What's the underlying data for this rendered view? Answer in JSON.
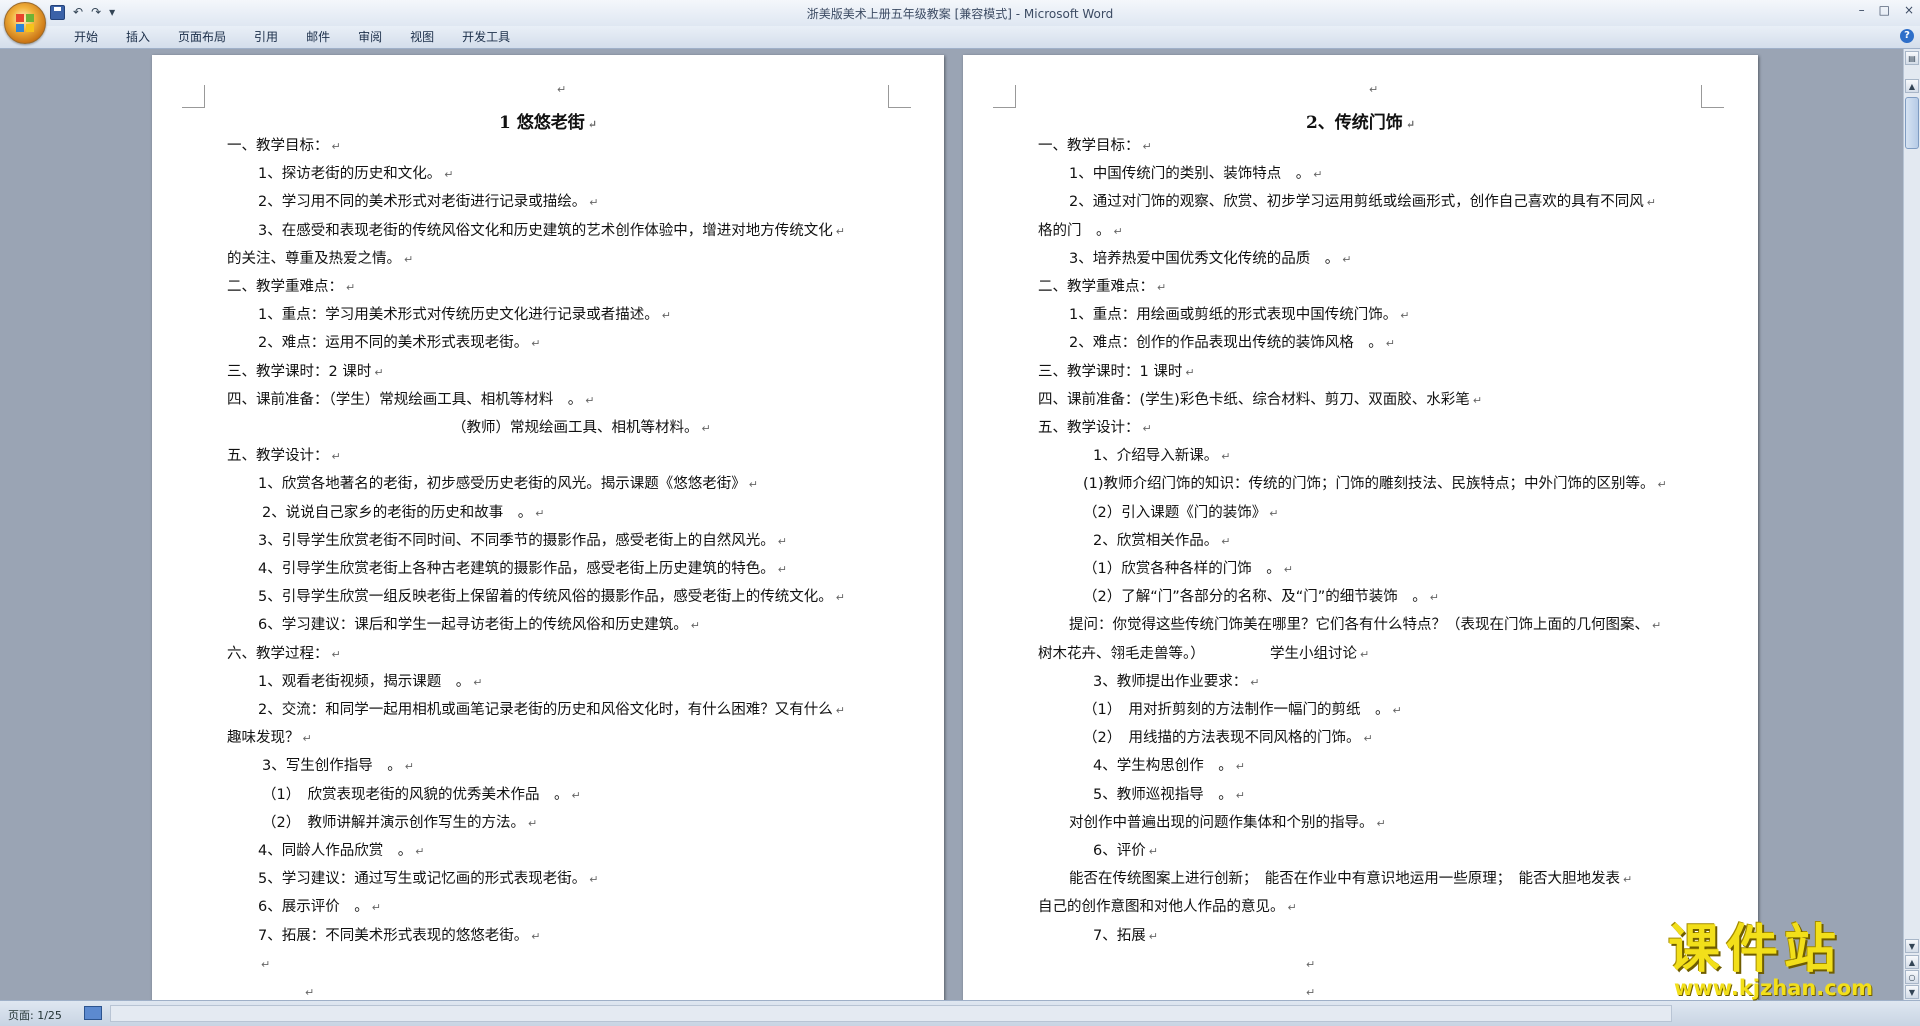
{
  "window": {
    "title": "浙美版美术上册五年级教案 [兼容模式] - Microsoft Word",
    "controls": [
      "–",
      "□",
      "×"
    ]
  },
  "quick_access": [
    "save-icon",
    "↶",
    "↷",
    "▾"
  ],
  "ribbon": {
    "tabs": [
      "开始",
      "插入",
      "页面布局",
      "引用",
      "邮件",
      "审阅",
      "视图",
      "开发工具"
    ],
    "help": "?"
  },
  "status": {
    "page": "页面: 1/25"
  },
  "watermark": {
    "main": "课件站",
    "url": "www.kjzhan.com"
  },
  "page1": {
    "title": "1 悠悠老街",
    "lines": [
      "一、教学目标：",
      "1、探访老街的历史和文化。",
      "2、学习用不同的美术形式对老街进行记录或描绘。",
      "3、在感受和表现老街的传统风俗文化和历史建筑的艺术创作体验中，增进对地方传统文化",
      "的关注、尊重及热爱之情。",
      "二、教学重难点：",
      "1、重点：学习用美术形式对传统历史文化进行记录或者描述。",
      "2、难点：运用不同的美术形式表现老街。",
      "三、教学课时：2 课时",
      "四、课前准备：（学生）常规绘画工具、相机等材料　。",
      "（教师）常规绘画工具、相机等材料。",
      "五、教学设计：",
      "1、欣赏各地著名的老街，初步感受历史老街的风光。揭示课题《悠悠老街》",
      "2、说说自己家乡的老街的历史和故事　。",
      "3、引导学生欣赏老街不同时间、不同季节的摄影作品，感受老街上的自然风光。",
      "4、引导学生欣赏老街上各种古老建筑的摄影作品，感受老街上历史建筑的特色。",
      "5、引导学生欣赏一组反映老街上保留着的传统风俗的摄影作品，感受老街上的传统文化。",
      "6、学习建议：课后和学生一起寻访老街上的传统风俗和历史建筑。",
      "六、教学过程：",
      "1、观看老街视频，揭示课题　。",
      "2、交流：和同学一起用相机或画笔记录老街的历史和风俗文化时，有什么困难？又有什么",
      "趣味发现？",
      "3、写生创作指导　。",
      "（1）　欣赏表现老街的风貌的优秀美术作品　。",
      "（2）　教师讲解并演示创作写生的方法。",
      "4、同龄人作品欣赏　。",
      "5、学习建议：通过写生或记忆画的形式表现老街。",
      "6、展示评价　。",
      "7、拓展：不同美术形式表现的悠悠老街。",
      "",
      ""
    ]
  },
  "page2": {
    "title": "2、传统门饰",
    "lines": [
      "一、教学目标：",
      "1、中国传统门的类别、装饰特点　。",
      "2、通过对门饰的观察、欣赏、初步学习运用剪纸或绘画形式，创作自己喜欢的具有不同风",
      "格的门　。",
      "3、培养热爱中国优秀文化传统的品质　。",
      "二、教学重难点：",
      "1、重点：用绘画或剪纸的形式表现中国传统门饰。",
      "2、难点：创作的作品表现出传统的装饰风格　。",
      "三、教学课时：1 课时",
      "四、课前准备：(学生)彩色卡纸、综合材料、剪刀、双面胶、水彩笔",
      "五、教学设计：",
      "1、介绍导入新课。",
      "(1)教师介绍门饰的知识：传统的门饰；门饰的雕刻技法、民族特点；中外门饰的区别等。",
      "（2）引入课题《门的装饰》",
      "2、欣赏相关作品。",
      "（1）欣赏各种各样的门饰　。",
      "（2）了解“门”各部分的名称、及“门”的细节装饰　。",
      "提问：你觉得这些传统门饰美在哪里？它们各有什么特点？（表现在门饰上面的几何图案、",
      "树木花卉、翎毛走兽等。）　　　　　学生小组讨论",
      "3、教师提出作业要求：",
      "（1）　用对折剪刻的方法制作一幅门的剪纸　。",
      "（2）　用线描的方法表现不同风格的门饰。",
      "4、学生构思创作　。",
      "5、教师巡视指导　。",
      "对创作中普遍出现的问题作集体和个别的指导。",
      "6、评价",
      "能否在传统图案上进行创新；　能否在作业中有意识地运用一些原理；　能否大胆地发表",
      "自己的创作意图和对他人作品的意见。",
      "7、拓展",
      "",
      ""
    ]
  }
}
